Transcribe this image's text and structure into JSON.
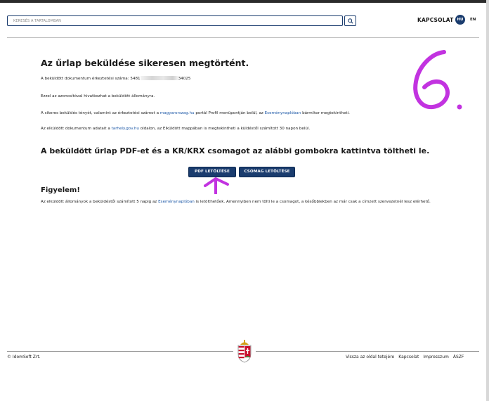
{
  "header": {
    "search_placeholder": "KERESÉS A TARTALOMBAN",
    "contact_label": "KAPCSOLAT",
    "lang_active": "HU",
    "lang_other": "EN"
  },
  "main": {
    "success_title": "Az űrlap beküldése sikeresen megtörtént.",
    "registry_prefix": "A beküldött dokumentum érkeztetési száma: 5481",
    "registry_suffix": "34025",
    "reference_text": "Ezzel az azonosítóval hivatkozhat a beküldött állományra.",
    "p3_a": "A sikeres beküldés tényét, valamint az érkeztetési számot a ",
    "p3_link1": "magyarorszag.hu",
    "p3_b": " portál Profil menüpontján belül, az ",
    "p3_link2": "Eseménynaplóban",
    "p3_c": " bármikor megtekintheti.",
    "p4_a": "Az elküldött dokumentum adatait a ",
    "p4_link": "tarhely.gov.hu",
    "p4_b": " oldalon, az Elküldött mappában is megtekintheti a küldéstől számított 30 napon belül.",
    "download_title": "A beküldött űrlap PDF-et és a KR/KRX csomagot az alábbi gombokra kattintva töltheti le.",
    "pdf_button": "PDF LETÖLTÉSE",
    "package_button": "CSOMAG LETÖLTÉSE",
    "warning_title": "Figyelem!",
    "warn_a": "Az elküldött állományok a beküldéstől számított 5 napig az ",
    "warn_link": "Eseménynaplóban",
    "warn_b": " is letölthetőek. Amennyiben nem tölti le a csomagot, a későbbiekben az már csak a címzett szervezetnél lesz elérhető."
  },
  "annotations": {
    "step_number": "6.",
    "color": "#c233e0"
  },
  "footer": {
    "copyright": "© IdomSoft Zrt.",
    "links": [
      "Vissza az oldal tetejére",
      "Kapcsolat",
      "Impresszum",
      "ÁSZF"
    ]
  },
  "colors": {
    "brand": "#1a3c6e",
    "link": "#1a56a6"
  }
}
